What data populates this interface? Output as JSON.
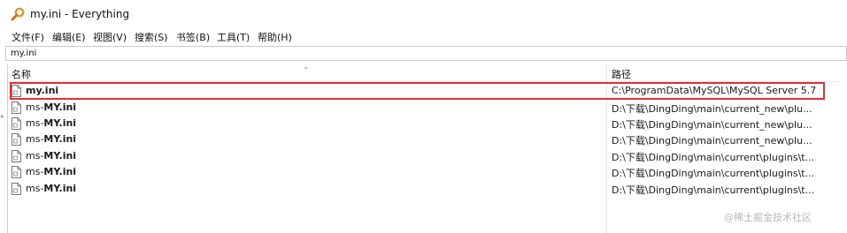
{
  "window": {
    "title": "my.ini - Everything",
    "app_icon": "magnifier-icon"
  },
  "menu": [
    {
      "label": "文件(F)"
    },
    {
      "label": "编辑(E)"
    },
    {
      "label": "视图(V)"
    },
    {
      "label": "搜索(S)"
    },
    {
      "label": "书签(B)"
    },
    {
      "label": "工具(T)"
    },
    {
      "label": "帮助(H)"
    }
  ],
  "search": {
    "value": "my.ini"
  },
  "columns": {
    "name": "名称",
    "path": "路径"
  },
  "results": [
    {
      "prefix": "",
      "match": "my.ini",
      "path": "C:\\ProgramData\\MySQL\\MySQL Server 5.7"
    },
    {
      "prefix": "ms-",
      "match": "MY.ini",
      "path": "D:\\下载\\DingDing\\main\\current_new\\plu..."
    },
    {
      "prefix": "ms-",
      "match": "MY.ini",
      "path": "D:\\下载\\DingDing\\main\\current_new\\plu..."
    },
    {
      "prefix": "ms-",
      "match": "MY.ini",
      "path": "D:\\下载\\DingDing\\main\\current_new\\plu..."
    },
    {
      "prefix": "ms-",
      "match": "MY.ini",
      "path": "D:\\下载\\DingDing\\main\\current\\plugins\\t..."
    },
    {
      "prefix": "ms-",
      "match": "MY.ini",
      "path": "D:\\下载\\DingDing\\main\\current\\plugins\\t..."
    },
    {
      "prefix": "ms-",
      "match": "MY.ini",
      "path": "D:\\下载\\DingDing\\main\\current\\plugins\\t..."
    }
  ],
  "colors": {
    "highlight": "#d9333b",
    "icon": "#e0962a"
  },
  "watermark": "@稀土掘金技术社区"
}
